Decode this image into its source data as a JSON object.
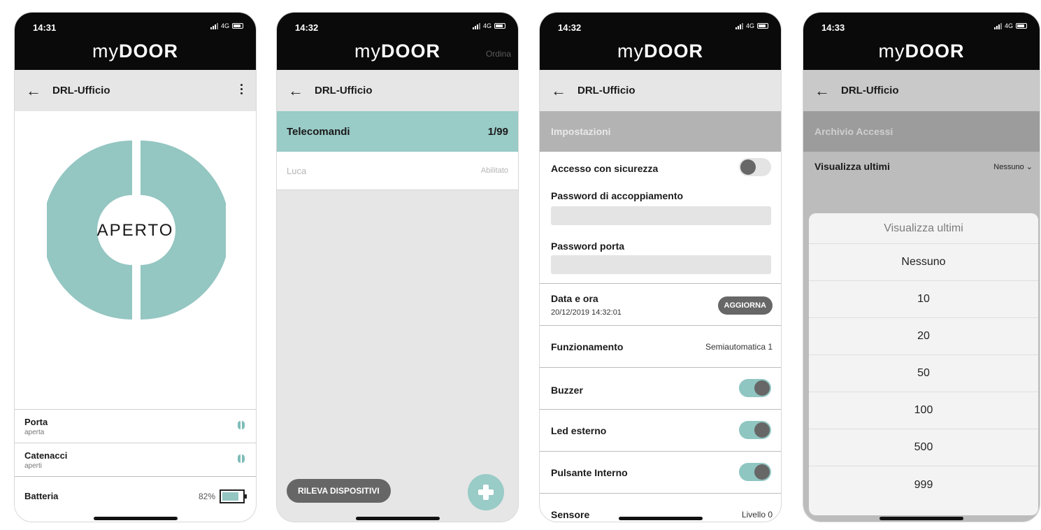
{
  "brand": {
    "my": "my",
    "door": "DOOR"
  },
  "screens": [
    {
      "time": "14:31",
      "network": "4G",
      "nav_title": "DRL-Ufficio",
      "state_label": "APERTO",
      "rows": [
        {
          "title": "Porta",
          "subtitle": "aperta"
        },
        {
          "title": "Catenacci",
          "subtitle": "aperti"
        },
        {
          "title": "Batteria",
          "value": "82%",
          "level": 0.82
        }
      ],
      "colors": {
        "accent": "#94c6c2"
      }
    },
    {
      "time": "14:32",
      "network": "4G",
      "nav_title": "DRL-Ufficio",
      "order_label": "Ordina",
      "section": {
        "title": "Telecomandi",
        "count": "1/99"
      },
      "items": [
        {
          "name": "Luca",
          "status": "Abilitato"
        }
      ],
      "detect_button": "RILEVA DISPOSITIVI",
      "add_icon": "plus-icon"
    },
    {
      "time": "14:32",
      "network": "4G",
      "nav_title": "DRL-Ufficio",
      "section_title": "Impostazioni",
      "secure_access": {
        "label": "Accesso con sicurezza",
        "on": false
      },
      "pairing_password": {
        "label": "Password di accoppiamento",
        "value": ""
      },
      "door_password": {
        "label": "Password porta",
        "value": ""
      },
      "datetime": {
        "label": "Data e ora",
        "value": "20/12/2019 14:32:01",
        "button": "AGGIORNA"
      },
      "mode": {
        "label": "Funzionamento",
        "value": "Semiautomatica 1"
      },
      "buzzer": {
        "label": "Buzzer",
        "on": true
      },
      "led": {
        "label": "Led esterno",
        "on": true
      },
      "internal_button": {
        "label": "Pulsante Interno",
        "on": true
      },
      "sensor": {
        "label": "Sensore",
        "value": "Livello 0"
      }
    },
    {
      "time": "14:33",
      "network": "4G",
      "nav_title": "DRL-Ufficio",
      "section_title": "Archivio Accessi",
      "view_last": {
        "label": "Visualizza ultimi",
        "value": "Nessuno"
      },
      "picker": {
        "title": "Visualizza ultimi",
        "options": [
          "Nessuno",
          "10",
          "20",
          "50",
          "100",
          "500",
          "999"
        ]
      }
    }
  ]
}
